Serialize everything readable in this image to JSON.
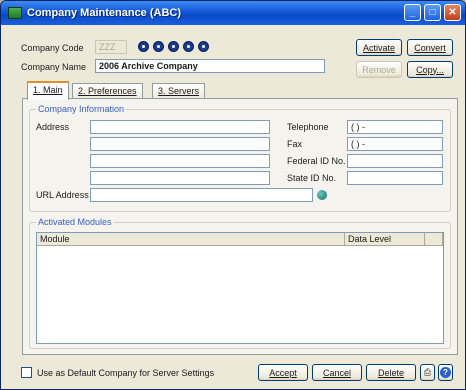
{
  "window": {
    "title": "Company Maintenance (ABC)"
  },
  "header": {
    "company_code_label": "Company Code",
    "company_code_value": "ZZZ",
    "company_name_label": "Company Name",
    "company_name_value": "2006 Archive Company"
  },
  "actions": {
    "activate": "Activate",
    "convert": "Convert",
    "remove": "Remove",
    "copy": "Copy..."
  },
  "tabs": [
    {
      "label": "1. Main",
      "active": true
    },
    {
      "label": "2. Preferences",
      "active": false
    },
    {
      "label": "3. Servers",
      "active": false
    }
  ],
  "company_info": {
    "group_title": "Company Information",
    "address_label": "Address",
    "url_label": "URL Address",
    "telephone_label": "Telephone",
    "telephone_value": "(  )   -",
    "fax_label": "Fax",
    "fax_value": "(  )   -",
    "federal_id_label": "Federal ID No.",
    "state_id_label": "State ID No."
  },
  "activated_modules": {
    "group_title": "Activated Modules",
    "columns": [
      "Module",
      "Data Level"
    ]
  },
  "footer": {
    "default_checkbox_label": "Use as Default Company for Server Settings",
    "accept": "Accept",
    "cancel": "Cancel",
    "delete": "Delete"
  }
}
